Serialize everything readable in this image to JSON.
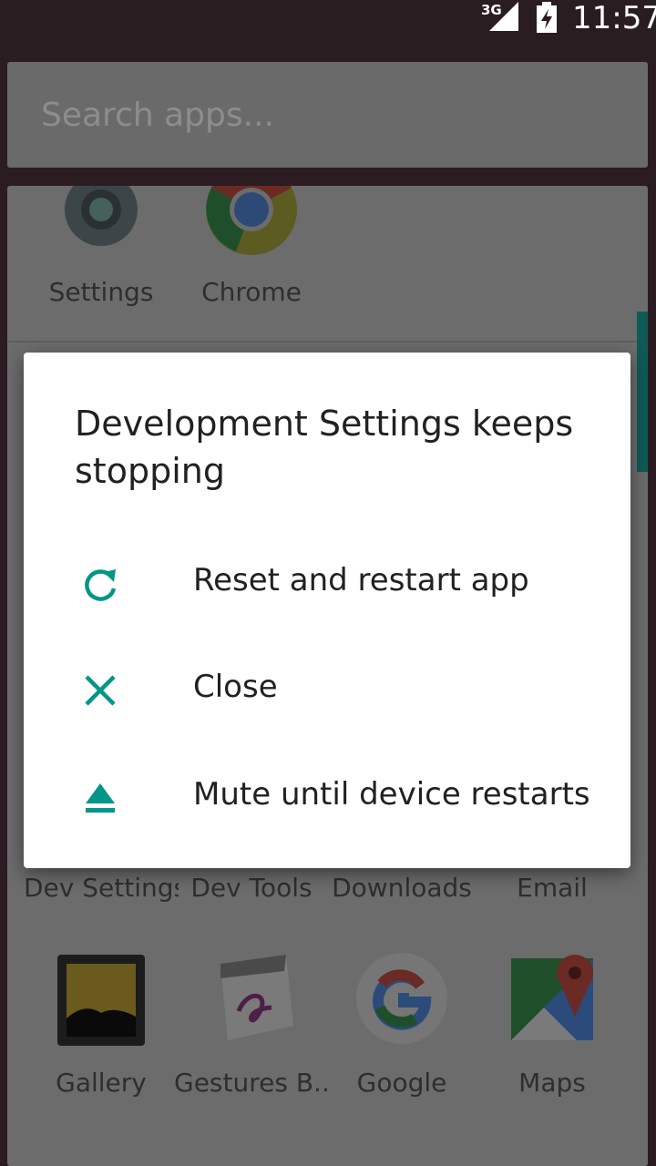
{
  "status_bar": {
    "network": "3G",
    "time": "11:57"
  },
  "search": {
    "placeholder": "Search apps..."
  },
  "apps": {
    "top_row": [
      {
        "label": "Settings",
        "icon": "settings-gear-icon"
      },
      {
        "label": "Chrome",
        "icon": "chrome-icon"
      }
    ],
    "middle_row": [
      {
        "label": "Dev Settings"
      },
      {
        "label": "Dev Tools"
      },
      {
        "label": "Downloads"
      },
      {
        "label": "Email"
      }
    ],
    "bottom_row": [
      {
        "label": "Gallery",
        "icon": "gallery-icon"
      },
      {
        "label": "Gestures B..",
        "icon": "gestures-builder-icon"
      },
      {
        "label": "Google",
        "icon": "google-icon"
      },
      {
        "label": "Maps",
        "icon": "maps-icon"
      }
    ]
  },
  "dialog": {
    "title": "Development Settings keeps stopping",
    "options": [
      {
        "label": "Reset and restart app",
        "icon": "restart-icon"
      },
      {
        "label": "Close",
        "icon": "close-icon"
      },
      {
        "label": "Mute until device restarts",
        "icon": "eject-icon"
      }
    ],
    "accent_color": "#009688"
  }
}
